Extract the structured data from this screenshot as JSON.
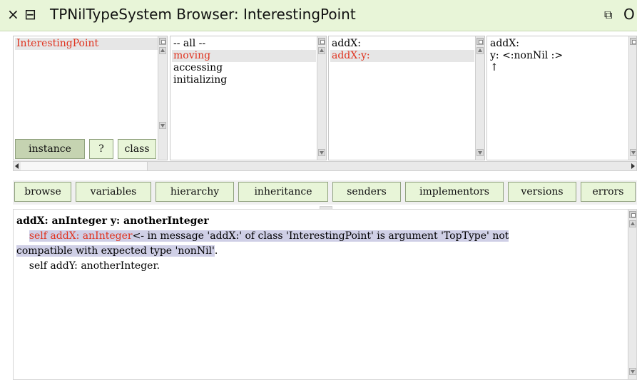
{
  "window": {
    "title": "TPNilTypeSystem Browser: InterestingPoint",
    "close_glyph": "×",
    "menu_glyph": "⊟",
    "collapse_glyph": "⧉",
    "extra_glyph": "O"
  },
  "class_pane": {
    "items": [
      "InterestingPoint"
    ],
    "selected": "InterestingPoint"
  },
  "class_toggle": {
    "instance": "instance",
    "help": "?",
    "class": "class"
  },
  "category_pane": {
    "items": [
      "-- all --",
      "moving",
      "accessing",
      "initializing"
    ],
    "selected": "moving"
  },
  "method_pane": {
    "items": [
      "addX:",
      "addX:y:"
    ],
    "selected": "addX:y:"
  },
  "type_pane": {
    "lines": [
      "addX:",
      "y: <:nonNil :>",
      "↑"
    ]
  },
  "toolbar": {
    "buttons": [
      "browse",
      "variables",
      "hierarchy",
      "inheritance",
      "senders",
      "implementors",
      "versions",
      "errors"
    ]
  },
  "code": {
    "signature": "addX: anInteger y: anotherInteger",
    "line1_indent": "    ",
    "line1_code": "self addX: anInteger",
    "error_part1": "<- in message 'addX:' of class 'InterestingPoint' is argument 'TopType' not",
    "error_part2": "compatible with expected type 'nonNil'",
    "error_dot": ".",
    "line3": "    self addY: anotherInteger."
  },
  "colors": {
    "titlebar": "#e8f5d8",
    "button": "#e8f5d8",
    "button_active": "#c5d3b1",
    "selection_red": "#e0321e",
    "error_highlight": "#cfcfe6"
  }
}
